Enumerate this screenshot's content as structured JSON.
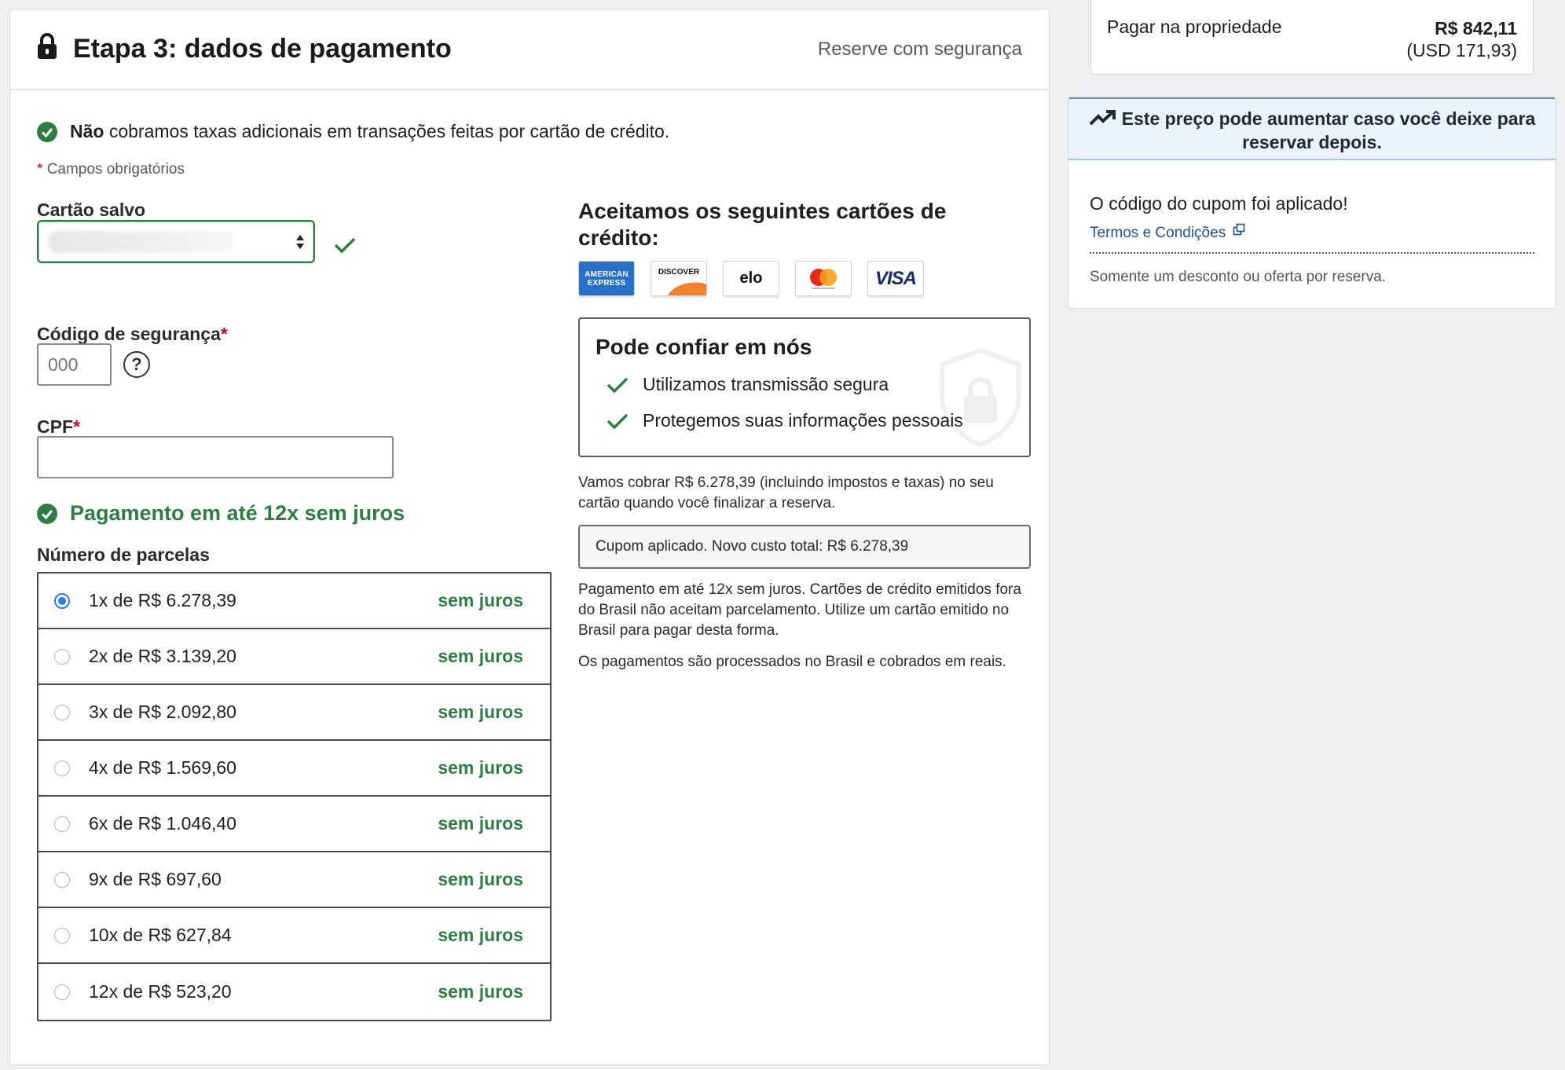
{
  "header": {
    "title": "Etapa 3: dados de pagamento",
    "secure_label": "Reserve com segurança"
  },
  "notice": {
    "bold": "Não",
    "text": " cobramos taxas adicionais em transações feitas por cartão de crédito."
  },
  "required_note": {
    "star": "*",
    "text": "Campos obrigatórios"
  },
  "form": {
    "saved_card_label": "Cartão salvo",
    "security_code_label": "Código de segurança",
    "security_code_placeholder": "000",
    "required_star": "*",
    "help_glyph": "?",
    "cpf_label": "CPF"
  },
  "installments": {
    "title": "Pagamento em até 12x sem juros",
    "label": "Número de parcelas",
    "options": [
      {
        "label": "1x de R$ 6.278,39",
        "badge": "sem juros"
      },
      {
        "label": "2x de R$ 3.139,20",
        "badge": "sem juros"
      },
      {
        "label": "3x de R$ 2.092,80",
        "badge": "sem juros"
      },
      {
        "label": "4x de R$ 1.569,60",
        "badge": "sem juros"
      },
      {
        "label": "6x de R$ 1.046,40",
        "badge": "sem juros"
      },
      {
        "label": "9x de R$ 697,60",
        "badge": "sem juros"
      },
      {
        "label": "10x de R$ 627,84",
        "badge": "sem juros"
      },
      {
        "label": "12x de R$ 523,20",
        "badge": "sem juros"
      }
    ]
  },
  "accepted": {
    "title": "Aceitamos os seguintes cartões de crédito:",
    "cards": {
      "amex_line1": "AMERICAN",
      "amex_line2": "EXPRESS",
      "discover": "DISCOVER",
      "elo": "elo",
      "visa": "VISA"
    }
  },
  "trust": {
    "title": "Pode confiar em nós",
    "items": [
      "Utilizamos transmissão segura",
      "Protegemos suas informações pessoais"
    ]
  },
  "charge_note": "Vamos cobrar R$ 6.278,39 (incluindo impostos e taxas) no seu cartão quando você finalizar a reserva.",
  "coupon_total": "Cupom aplicado. Novo custo total: R$ 6.278,39",
  "installment_note": "Pagamento em até 12x sem juros. Cartões de crédito emitidos fora do Brasil não aceitam parcelamento. Utilize um cartão emitido no Brasil para pagar desta forma.",
  "processed_note": "Os pagamentos são processados no Brasil e cobrados em reais.",
  "sidebar": {
    "pay_at_property": "Pagar na propriedade",
    "amount_brl": "R$ 842,11",
    "amount_usd": "(USD 171,93)",
    "price_alert": "Este preço pode aumentar caso você deixe para reservar depois.",
    "coupon_applied": "O código do cupom foi aplicado!",
    "terms_link": "Termos e Condições",
    "one_discount": "Somente um desconto ou oferta por reserva."
  },
  "colors": {
    "success_green": "#2f7d45",
    "link_blue": "#1d4f8c",
    "radio_blue": "#2f7de1",
    "alert_bg": "#eaf3fb"
  }
}
